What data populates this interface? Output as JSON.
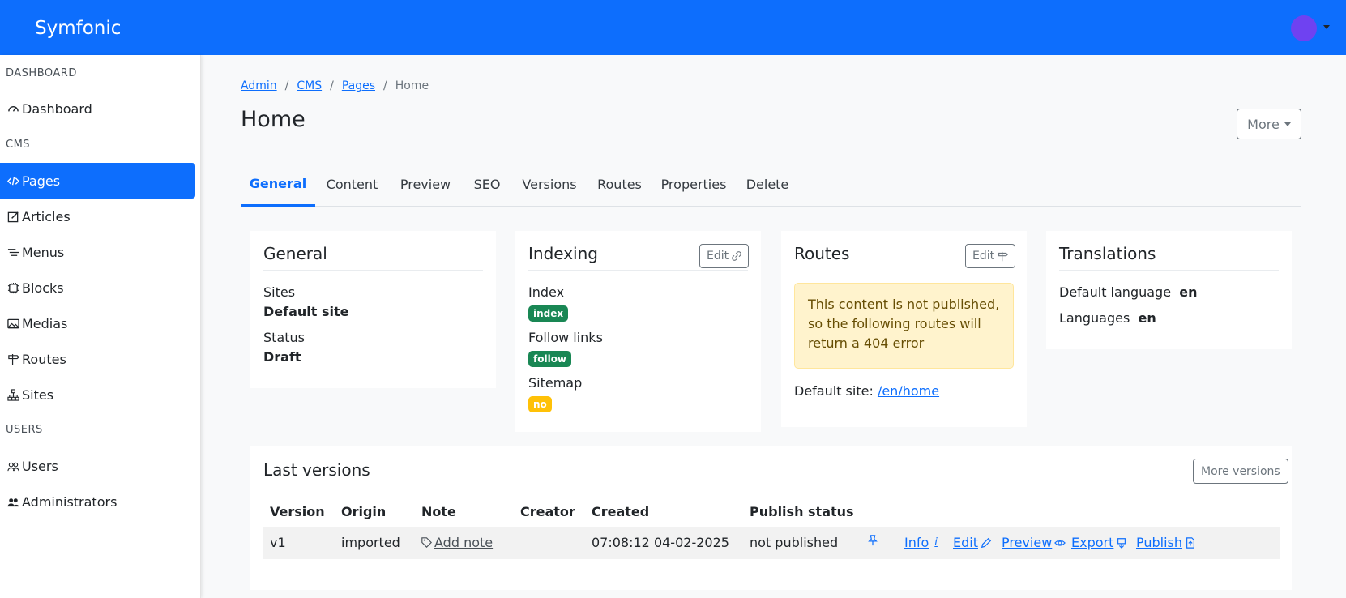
{
  "app": {
    "brand": "Symfonic"
  },
  "sidebar": {
    "sections": [
      "DASHBOARD",
      "CMS",
      "USERS"
    ],
    "items": [
      {
        "label": "Dashboard",
        "icon": "gauge-icon"
      },
      {
        "label": "Pages",
        "icon": "code-icon",
        "active": true
      },
      {
        "label": "Articles",
        "icon": "pencil-square-icon"
      },
      {
        "label": "Menus",
        "icon": "menu-lines-icon"
      },
      {
        "label": "Blocks",
        "icon": "cpu-icon"
      },
      {
        "label": "Medias",
        "icon": "image-icon"
      },
      {
        "label": "Routes",
        "icon": "signpost-icon"
      },
      {
        "label": "Sites",
        "icon": "diagram-icon"
      },
      {
        "label": "Users",
        "icon": "people-icon"
      },
      {
        "label": "Administrators",
        "icon": "people-fill-icon"
      }
    ]
  },
  "breadcrumb": [
    "Admin",
    "CMS",
    "Pages",
    "Home"
  ],
  "page": {
    "title": "Home",
    "more_label": "More"
  },
  "tabs": [
    "General",
    "Content",
    "Preview",
    "SEO",
    "Versions",
    "Routes",
    "Properties",
    "Delete"
  ],
  "general": {
    "title": "General",
    "sites_label": "Sites",
    "sites_value": "Default site",
    "status_label": "Status",
    "status_value": "Draft"
  },
  "indexing": {
    "title": "Indexing",
    "edit_label": "Edit",
    "index_label": "Index",
    "index_badge": "index",
    "follow_label": "Follow links",
    "follow_badge": "follow",
    "sitemap_label": "Sitemap",
    "sitemap_badge": "no"
  },
  "routes": {
    "title": "Routes",
    "edit_label": "Edit",
    "alert": "This content is not published, so the following routes will return a 404 error",
    "default_site_label": "Default site:",
    "default_site_link": "/en/home"
  },
  "translations": {
    "title": "Translations",
    "default_language_label": "Default language",
    "default_language_value": "en",
    "languages_label": "Languages",
    "languages_value": "en"
  },
  "versions": {
    "title": "Last versions",
    "more_label": "More versions",
    "headers": [
      "Version",
      "Origin",
      "Note",
      "Creator",
      "Created",
      "Publish status"
    ],
    "row": {
      "version": "v1",
      "origin": "imported",
      "note": "Add note",
      "creator": "",
      "created": "07:08:12 04-02-2025",
      "publish_status": "not published"
    },
    "actions": {
      "info": "Info",
      "edit": "Edit",
      "preview": "Preview",
      "export": "Export",
      "publish": "Publish"
    }
  },
  "colors": {
    "primary": "#0d6efd",
    "success": "#198754",
    "warning": "#ffc107",
    "avatar": "#6f42f1"
  }
}
